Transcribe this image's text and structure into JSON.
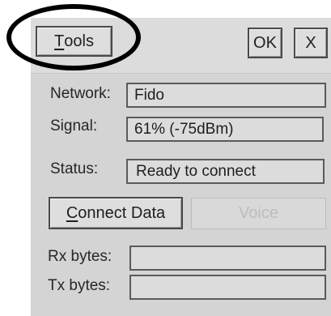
{
  "toolbar": {
    "tools_label_underlined": "T",
    "tools_label_rest": "ools",
    "ok_label": "OK",
    "close_label": "X"
  },
  "fields": {
    "network_label": "Network:",
    "network_value": "Fido",
    "signal_label": "Signal:",
    "signal_value": "61% (-75dBm)",
    "status_label": "Status:",
    "status_value": "Ready to connect",
    "rx_label": "Rx bytes:",
    "rx_value": "",
    "tx_label": "Tx bytes:",
    "tx_value": ""
  },
  "actions": {
    "connect_label_underlined": "C",
    "connect_label_rest": "onnect Data",
    "voice_label": "Voice"
  },
  "annotation": {
    "color": "#000000",
    "shape": "ellipse around Tools button"
  }
}
